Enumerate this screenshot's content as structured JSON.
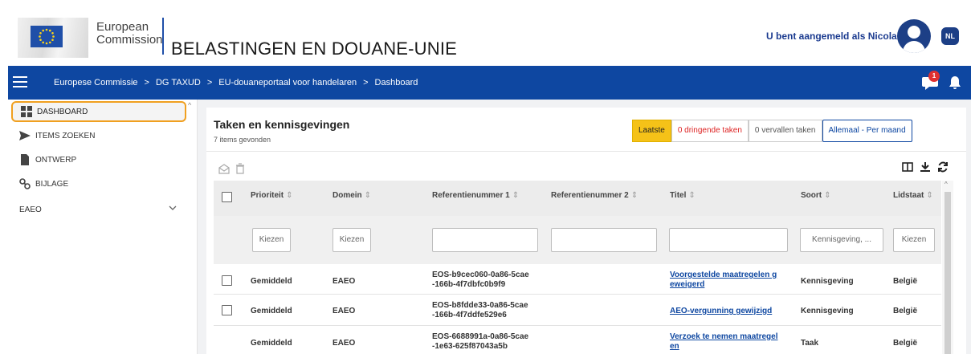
{
  "header": {
    "org_line1": "European",
    "org_line2": "Commission",
    "site_title": "BELASTINGEN EN DOUANE-UNIE",
    "user_text": "U bent aangemeld als Nicolas",
    "language": "NL"
  },
  "nav": {
    "breadcrumb": [
      "Europese Commissie",
      "DG TAXUD",
      "EU-douaneportaal voor handelaren",
      "Dashboard"
    ],
    "notification_count": "1"
  },
  "sidebar": {
    "items": [
      {
        "label": "DASHBOARD",
        "icon": "dashboard-icon",
        "active": true
      },
      {
        "label": "ITEMS ZOEKEN",
        "icon": "send-icon"
      },
      {
        "label": "ONTWERP",
        "icon": "document-icon"
      },
      {
        "label": "BIJLAGE",
        "icon": "attachment-icon"
      },
      {
        "label": "EAEO",
        "icon": "chevron-down-icon"
      }
    ]
  },
  "card": {
    "title": "Taken en kennisgevingen",
    "subtitle": "7 items gevonden",
    "filters": {
      "latest": "Laatste",
      "urgent": "0 dringende taken",
      "expired": "0 vervallen taken",
      "period": "Allemaal - Per maand"
    }
  },
  "table": {
    "columns": [
      "Prioriteit",
      "Domein",
      "Referentienummer 1",
      "Referentienummer 2",
      "Titel",
      "Soort",
      "Lidstaat"
    ],
    "filter_placeholders": {
      "priority": "Kiezen",
      "domain": "Kiezen",
      "ref1": "",
      "ref2": "",
      "title": "",
      "type": "Kennisgeving, ...",
      "state": "Kiezen"
    },
    "rows": [
      {
        "priority": "Gemiddeld",
        "domain": "EAEO",
        "ref1_a": "EOS-b9cec060-0a86-5cae",
        "ref1_b": "-166b-4f7dbfc0b9f9",
        "title_a": "Voorgestelde maatregelen g",
        "title_b": "eweigerd",
        "type": "Kennisgeving",
        "state": "België",
        "checkbox": true
      },
      {
        "priority": "Gemiddeld",
        "domain": "EAEO",
        "ref1_a": "EOS-b8fdde33-0a86-5cae",
        "ref1_b": "-166b-4f7ddfe529e6",
        "title_a": "AEO-vergunning gewijzigd",
        "title_b": "",
        "type": "Kennisgeving",
        "state": "België",
        "checkbox": true
      },
      {
        "priority": "Gemiddeld",
        "domain": "EAEO",
        "ref1_a": "EOS-6688991a-0a86-5cae",
        "ref1_b": "-1e63-625f87043a5b",
        "title_a": "Verzoek te nemen maatregel",
        "title_b": "en",
        "type": "Taak",
        "state": "België",
        "checkbox": false
      }
    ]
  },
  "colors": {
    "primary": "#0e47a1",
    "accent_yellow": "#f5c218",
    "active_outline": "#f0a020",
    "danger": "#d22222"
  }
}
